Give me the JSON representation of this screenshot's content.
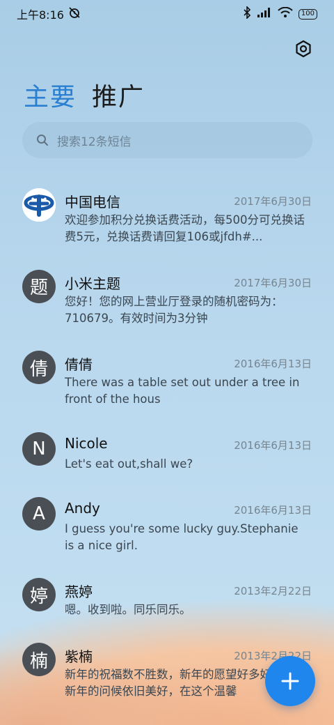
{
  "status_bar": {
    "time": "上午8:16",
    "battery": "100",
    "icons": [
      "silent-alarm-icon",
      "bluetooth-icon",
      "signal-icon",
      "wifi-icon",
      "battery-icon"
    ]
  },
  "header": {
    "settings_icon": "settings-hex-icon",
    "tabs": [
      {
        "label": "主要",
        "active": true
      },
      {
        "label": "推广",
        "active": false
      }
    ]
  },
  "search": {
    "placeholder": "搜索12条短信"
  },
  "messages": [
    {
      "avatar": "",
      "avatar_icon": "china-telecom-logo",
      "name": "中国电信",
      "date": "2017年6月30日",
      "preview": "欢迎参加积分兑换话费活动，每500分可兑换话费5元，兑换话费请回复106或jfdh#..."
    },
    {
      "avatar": "题",
      "name": "小米主题",
      "date": "2017年6月30日",
      "preview": "您好！您的网上营业厅登录的随机密码为：710679。有效时间为3分钟"
    },
    {
      "avatar": "倩",
      "name": "倩倩",
      "date": "2016年6月13日",
      "preview": "There was a table set out under a tree in front of the hous"
    },
    {
      "avatar": "N",
      "name": "Nicole",
      "date": "2016年6月13日",
      "preview": "Let's eat out,shall we?"
    },
    {
      "avatar": "A",
      "name": "Andy",
      "date": "2016年6月13日",
      "preview": "I guess you're some lucky guy.Stephanie is a nice girl."
    },
    {
      "avatar": "婷",
      "name": "燕婷",
      "date": "2013年2月22日",
      "preview": "嗯。收到啦。同乐同乐。"
    },
    {
      "avatar": "楠",
      "name": "紫楠",
      "date": "2013年2月22日",
      "preview": "新年的祝福数不胜数，新年的愿望好多好多，新年的问候依旧美好，在这个温馨"
    }
  ],
  "fab": {
    "icon": "plus-icon"
  },
  "colors": {
    "accent": "#2a7fd0",
    "fab": "#1f86ee",
    "avatar_bg": "#4a4f55"
  }
}
